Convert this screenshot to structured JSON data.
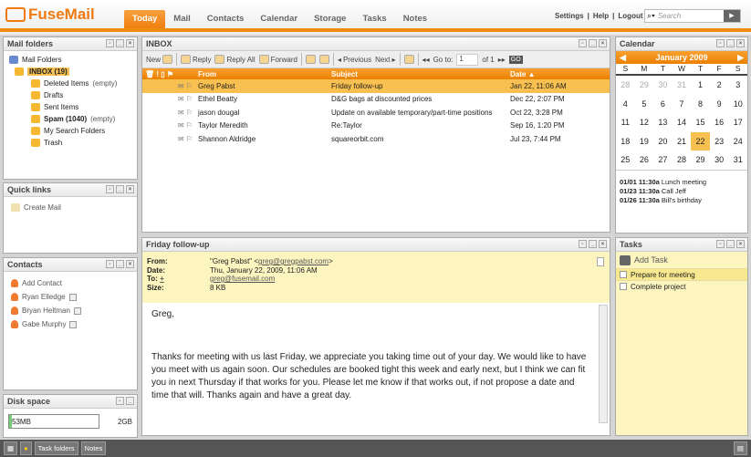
{
  "app": {
    "logo": "FuseMail"
  },
  "nav": {
    "tabs": [
      "Today",
      "Mail",
      "Contacts",
      "Calendar",
      "Storage",
      "Tasks",
      "Notes"
    ],
    "active": "Today"
  },
  "top_links": {
    "settings": "Settings",
    "help": "Help",
    "logout": "Logout",
    "search_placeholder": "Search"
  },
  "mail_folders": {
    "title": "Mail Folders",
    "panel_title": "Mail folders",
    "items": [
      {
        "label": "INBOX (19)",
        "extra": ""
      },
      {
        "label": "Deleted Items",
        "extra": "(empty)"
      },
      {
        "label": "Drafts",
        "extra": ""
      },
      {
        "label": "Sent Items",
        "extra": ""
      },
      {
        "label": "Spam (1040)",
        "extra": "(empty)"
      },
      {
        "label": "My Search Folders",
        "extra": ""
      },
      {
        "label": "Trash",
        "extra": ""
      }
    ]
  },
  "quick_links": {
    "title": "Quick links",
    "items": [
      "Create Mail"
    ]
  },
  "contacts": {
    "title": "Contacts",
    "add": "Add Contact",
    "items": [
      "Ryan Elledge",
      "Bryan Heltman",
      "Gabe Murphy"
    ]
  },
  "disk": {
    "title": "Disk space",
    "used": "53MB",
    "total": "2GB",
    "used_fraction": 0.026
  },
  "inbox": {
    "title": "INBOX",
    "toolbar": {
      "new": "New",
      "reply": "Reply",
      "reply_all": "Reply All",
      "forward": "Forward",
      "previous": "Previous",
      "next": "Next",
      "goto": "Go to:",
      "page": "1",
      "of": "of 1",
      "go": "GO"
    },
    "columns": [
      "From",
      "Subject",
      "Date"
    ],
    "messages": [
      {
        "from": "Greg Pabst",
        "subject": "Friday follow-up",
        "date": "Jan 22, 11:06 AM",
        "selected": true
      },
      {
        "from": "Ethel Beatty",
        "subject": "D&G bags at discounted prices",
        "date": "Dec 22, 2:07 PM"
      },
      {
        "from": "jason dougal",
        "subject": "Update on available temporary/part-time positions",
        "date": "Oct 22, 3:28 PM"
      },
      {
        "from": "Taylor Meredith",
        "subject": "Re:Taylor",
        "date": "Sep 16, 1:20 PM"
      },
      {
        "from": "Shannon Aldridge",
        "subject": "squareorbit.com",
        "date": "Jul 23, 7:44 PM"
      }
    ]
  },
  "message": {
    "title": "Friday follow-up",
    "from_label": "From:",
    "from_name": "\"Greg Pabst\" <",
    "from_email": "greg@gregpabst.com",
    "from_end": ">",
    "date_label": "Date:",
    "date": "Thu, January 22, 2009, 11:06 AM",
    "to_label": "To:",
    "to_plus": "+",
    "to": "greg@fusemail.com",
    "size_label": "Size:",
    "size": "8 KB",
    "greeting": "Greg,",
    "body": "Thanks for meeting with us last Friday, we appreciate you taking time out of your day.  We would like to have you meet with us again soon.  Our schedules are booked tight this week and early next, but I think we can fit you in next Thursday if that works for you.  Please let me know if that works out, if not propose a date and time that will.  Thanks again and have a great day."
  },
  "calendar": {
    "title": "Calendar",
    "month": "January 2009",
    "dow": [
      "S",
      "M",
      "T",
      "W",
      "T",
      "F",
      "S"
    ],
    "days": [
      "28",
      "29",
      "30",
      "31",
      "1",
      "2",
      "3",
      "4",
      "5",
      "6",
      "7",
      "8",
      "9",
      "10",
      "11",
      "12",
      "13",
      "14",
      "15",
      "16",
      "17",
      "18",
      "19",
      "20",
      "21",
      "22",
      "23",
      "24",
      "25",
      "26",
      "27",
      "28",
      "29",
      "30",
      "31"
    ],
    "today": "22",
    "events": [
      {
        "when": "01/01 11:30a",
        "what": "Lunch meeting"
      },
      {
        "when": "01/23 11:30a",
        "what": "Call Jeff"
      },
      {
        "when": "01/26 11:30a",
        "what": "Bill's birthday"
      }
    ]
  },
  "tasks": {
    "title": "Tasks",
    "add": "Add Task",
    "items": [
      "Prepare for meeting",
      "Complete project"
    ]
  },
  "bottom": {
    "task_folders": "Task folders",
    "notes": "Notes"
  },
  "colors": {
    "accent": "#f08c10",
    "selected": "#f8c050",
    "message_header": "#fdf5c0"
  }
}
